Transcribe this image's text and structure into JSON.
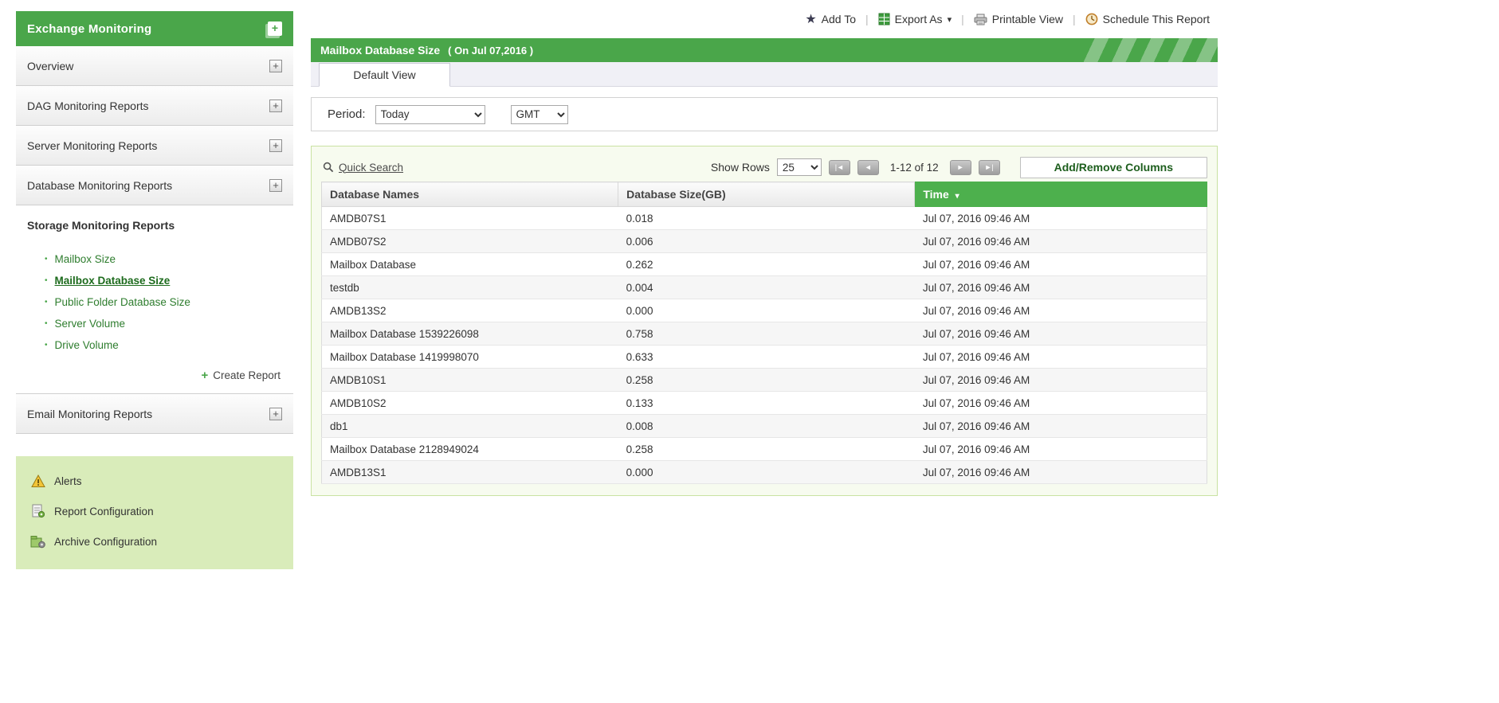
{
  "icons": {
    "plus": "+",
    "star": "★",
    "caret_down": "▾",
    "sort_desc": "▾",
    "nav_first": "|◄",
    "nav_prev": "◄",
    "nav_next": "►",
    "nav_last": "►|",
    "bullet": "●"
  },
  "colors": {
    "brand_green": "#4aa64a",
    "table_header_green": "#4db04d",
    "footer_panel_green": "#d9ecba"
  },
  "sidebar": {
    "title": "Exchange Monitoring",
    "collapsed_items": [
      "Overview",
      "DAG Monitoring Reports",
      "Server Monitoring Reports",
      "Database Monitoring Reports"
    ],
    "storage_section": {
      "label": "Storage Monitoring Reports",
      "items": [
        "Mailbox Size",
        "Mailbox Database Size",
        "Public Folder Database Size",
        "Server Volume",
        "Drive Volume"
      ],
      "create_report_label": "Create Report"
    },
    "email_item": "Email Monitoring Reports",
    "footer_items": [
      "Alerts",
      "Report Configuration",
      "Archive Configuration"
    ]
  },
  "toolbar": {
    "add_to": "Add To",
    "export_as": "Export As",
    "printable_view": "Printable View",
    "schedule": "Schedule This Report"
  },
  "header": {
    "title": "Mailbox Database Size",
    "subtitle": "( On Jul 07,2016 )"
  },
  "tabs": {
    "default_view": "Default View"
  },
  "filters": {
    "period_label": "Period:",
    "period_value": "Today",
    "timezone_value": "GMT"
  },
  "table_toolbar": {
    "quick_search": "Quick Search",
    "show_rows_label": "Show Rows",
    "show_rows_value": "25",
    "range_text": "1-12 of 12",
    "add_remove_columns": "Add/Remove Columns"
  },
  "table": {
    "columns": [
      "Database Names",
      "Database Size(GB)",
      "Time"
    ],
    "rows": [
      [
        "AMDB07S1",
        "0.018",
        "Jul 07, 2016 09:46 AM"
      ],
      [
        "AMDB07S2",
        "0.006",
        "Jul 07, 2016 09:46 AM"
      ],
      [
        "Mailbox Database",
        "0.262",
        "Jul 07, 2016 09:46 AM"
      ],
      [
        "testdb",
        "0.004",
        "Jul 07, 2016 09:46 AM"
      ],
      [
        "AMDB13S2",
        "0.000",
        "Jul 07, 2016 09:46 AM"
      ],
      [
        "Mailbox Database 1539226098",
        "0.758",
        "Jul 07, 2016 09:46 AM"
      ],
      [
        "Mailbox Database 1419998070",
        "0.633",
        "Jul 07, 2016 09:46 AM"
      ],
      [
        "AMDB10S1",
        "0.258",
        "Jul 07, 2016 09:46 AM"
      ],
      [
        "AMDB10S2",
        "0.133",
        "Jul 07, 2016 09:46 AM"
      ],
      [
        "db1",
        "0.008",
        "Jul 07, 2016 09:46 AM"
      ],
      [
        "Mailbox Database 2128949024",
        "0.258",
        "Jul 07, 2016 09:46 AM"
      ],
      [
        "AMDB13S1",
        "0.000",
        "Jul 07, 2016 09:46 AM"
      ]
    ]
  }
}
